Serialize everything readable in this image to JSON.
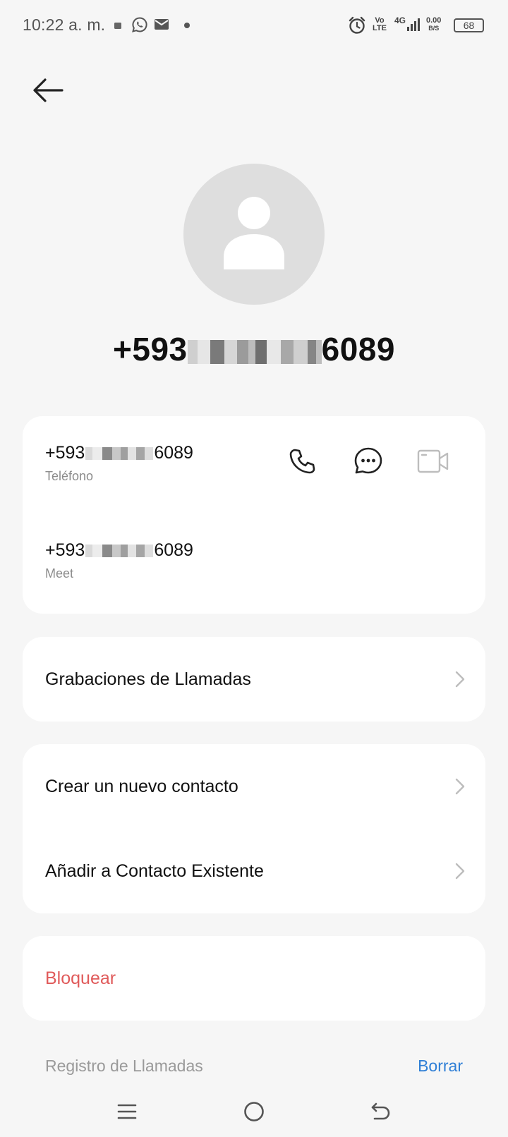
{
  "status_bar": {
    "time": "10:22 a. m.",
    "volte_top": "Vo",
    "volte_bottom": "LTE",
    "network": "4G",
    "speed_value": "0.00",
    "speed_unit": "B/S",
    "battery": "68",
    "icons": [
      "cast-icon",
      "whatsapp-icon",
      "mail-icon",
      "dot-icon",
      "alarm-icon",
      "volte-icon",
      "signal-icon",
      "battery-icon"
    ]
  },
  "header": {
    "back_icon": "arrow-left-icon"
  },
  "contact": {
    "title_prefix": "+593",
    "title_suffix": "6089",
    "avatar_icon": "person-icon"
  },
  "numbers": [
    {
      "prefix": "+593",
      "suffix": "6089",
      "type": "Teléfono"
    },
    {
      "prefix": "+593",
      "suffix": "6089",
      "type": "Meet"
    }
  ],
  "actions": {
    "call_icon": "phone-icon",
    "message_icon": "message-icon",
    "video_icon": "video-icon"
  },
  "menu": {
    "recordings": "Grabaciones de Llamadas",
    "create_contact": "Crear un nuevo contacto",
    "add_existing": "Añadir a Contacto Existente",
    "block": "Bloquear"
  },
  "call_log": {
    "header": "Registro de Llamadas",
    "clear": "Borrar"
  },
  "colors": {
    "accent_blue": "#2f7fd6",
    "danger_red": "#e05a5a",
    "background": "#f6f6f6"
  },
  "nav": {
    "icons": [
      "menu-icon",
      "home-icon",
      "back-icon"
    ]
  }
}
